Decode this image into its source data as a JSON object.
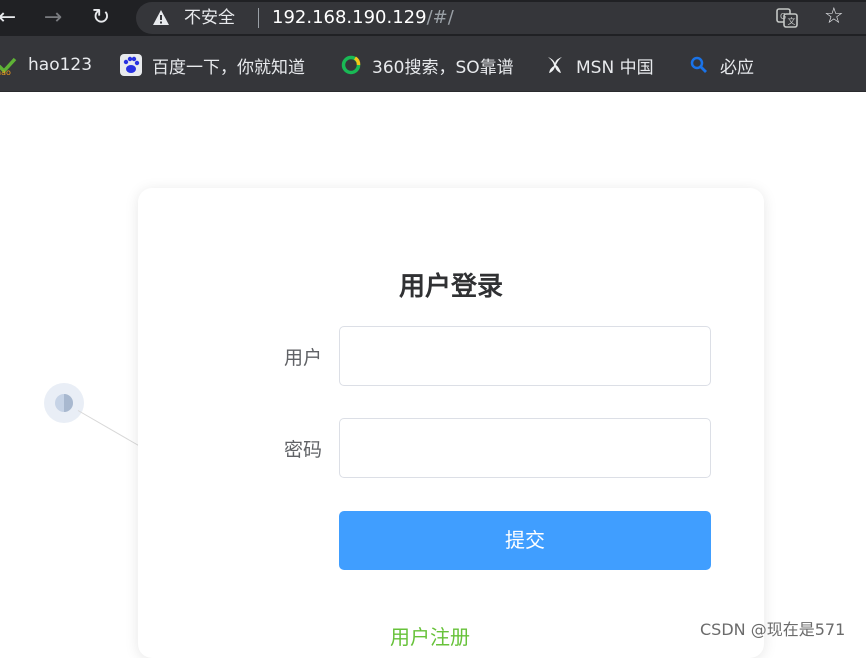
{
  "browser": {
    "insecure_label": "不安全",
    "url_host": "192.168.190.129",
    "url_path": "/#/"
  },
  "bookmarks": [
    {
      "label": "hao123",
      "icon": "hao123-icon"
    },
    {
      "label": "百度一下，你就知道",
      "icon": "baidu-paw-icon"
    },
    {
      "label": "360搜索，SO靠谱",
      "icon": "so360-icon"
    },
    {
      "label": "MSN 中国",
      "icon": "msn-butterfly-icon"
    },
    {
      "label": "必应",
      "icon": "bing-search-icon"
    }
  ],
  "login": {
    "title": "用户登录",
    "username_label": "用户",
    "password_label": "密码",
    "username_value": "",
    "password_value": "",
    "submit_label": "提交",
    "register_link": "用户注册"
  },
  "colors": {
    "primary": "#409eff",
    "link_green": "#67c23a",
    "chrome_dark": "#202124",
    "bookmark_bar": "#35363a"
  },
  "watermark": "CSDN @现在是571"
}
